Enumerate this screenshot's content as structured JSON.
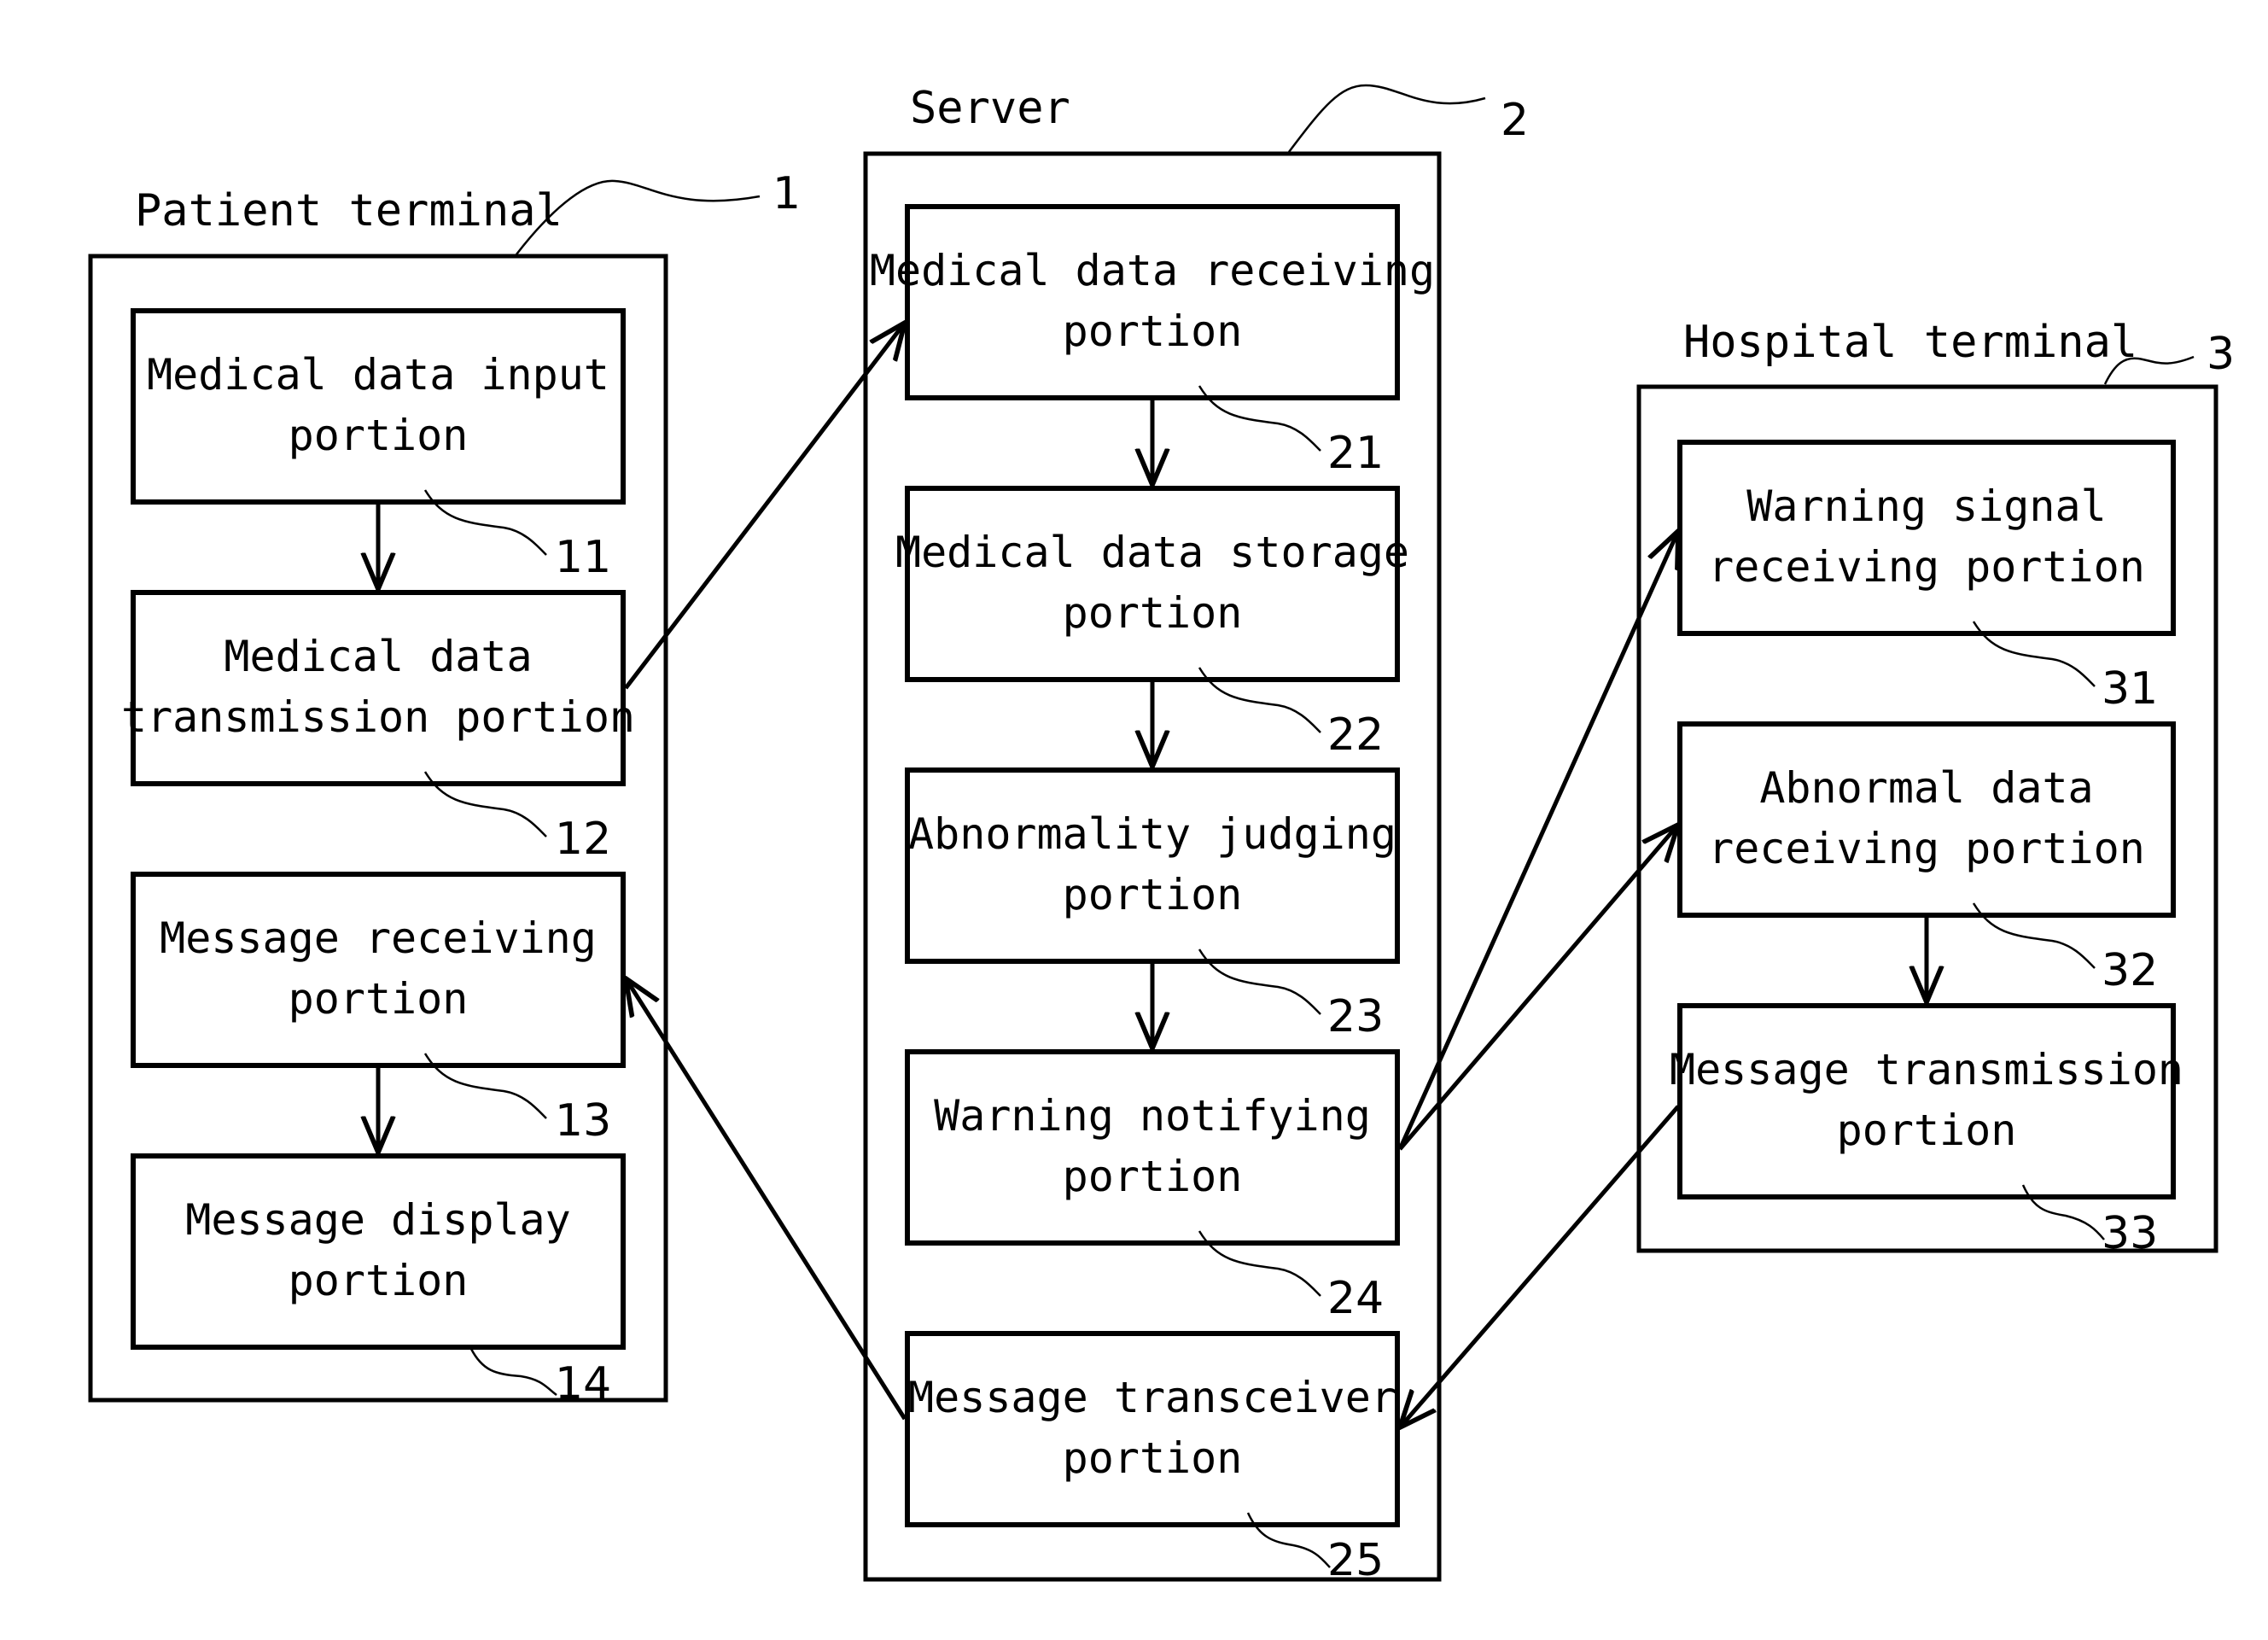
{
  "groups": {
    "patient": {
      "title": "Patient terminal",
      "ref": "1",
      "blocks": [
        {
          "line1": "Medical data input",
          "line2": "portion",
          "ref": "11"
        },
        {
          "line1": "Medical data",
          "line2": "transmission portion",
          "ref": "12"
        },
        {
          "line1": "Message receiving",
          "line2": "portion",
          "ref": "13"
        },
        {
          "line1": "Message display",
          "line2": "portion",
          "ref": "14"
        }
      ]
    },
    "server": {
      "title": "Server",
      "ref": "2",
      "blocks": [
        {
          "line1": "Medical data receiving",
          "line2": "portion",
          "ref": "21"
        },
        {
          "line1": "Medical data storage",
          "line2": "portion",
          "ref": "22"
        },
        {
          "line1": "Abnormality judging",
          "line2": "portion",
          "ref": "23"
        },
        {
          "line1": "Warning notifying",
          "line2": "portion",
          "ref": "24"
        },
        {
          "line1": "Message transceiver",
          "line2": "portion",
          "ref": "25"
        }
      ]
    },
    "hospital": {
      "title": "Hospital terminal",
      "ref": "3",
      "blocks": [
        {
          "line1": "Warning signal",
          "line2": "receiving portion",
          "ref": "31"
        },
        {
          "line1": "Abnormal data",
          "line2": "receiving portion",
          "ref": "32"
        },
        {
          "line1": "Message transmission",
          "line2": "portion",
          "ref": "33"
        }
      ]
    }
  },
  "connections": [
    {
      "from": "11",
      "to": "12"
    },
    {
      "from": "13",
      "to": "14"
    },
    {
      "from": "12",
      "to": "21"
    },
    {
      "from": "21",
      "to": "22"
    },
    {
      "from": "22",
      "to": "23"
    },
    {
      "from": "23",
      "to": "24"
    },
    {
      "from": "24",
      "to": "31"
    },
    {
      "from": "24",
      "to": "32"
    },
    {
      "from": "32",
      "to": "33"
    },
    {
      "from": "33",
      "to": "25"
    },
    {
      "from": "25",
      "to": "13"
    }
  ]
}
